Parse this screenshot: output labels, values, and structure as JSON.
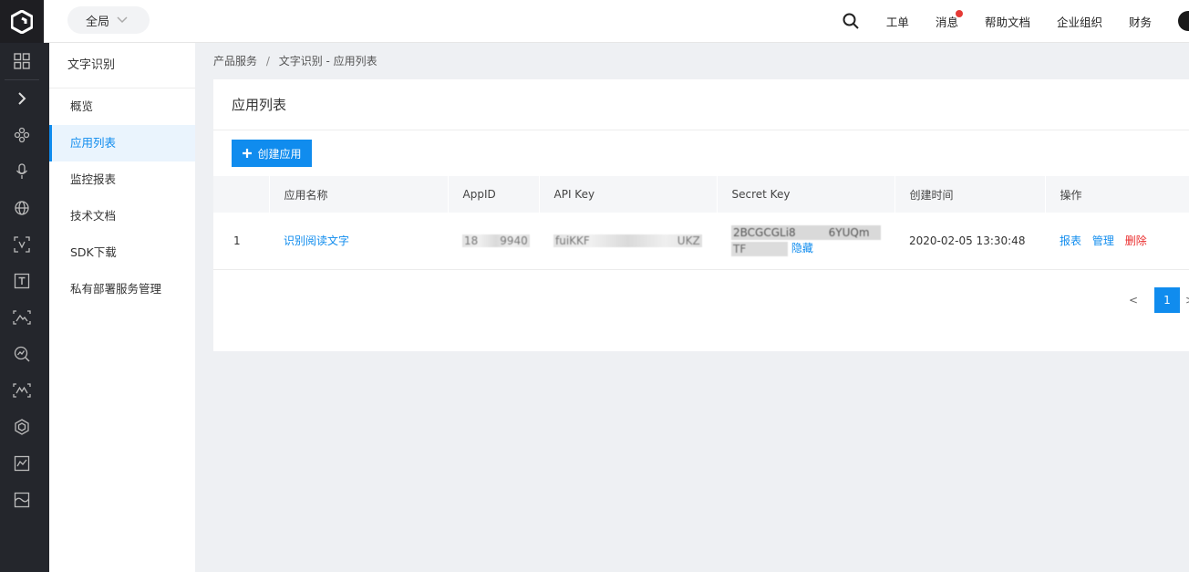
{
  "header": {
    "scope_select": "全局",
    "nav": [
      {
        "label": "工单"
      },
      {
        "label": "消息",
        "badge": true
      },
      {
        "label": "帮助文档"
      },
      {
        "label": "企业组织"
      },
      {
        "label": "财务"
      }
    ]
  },
  "sidebar": {
    "title": "文字识别",
    "items": [
      {
        "label": "概览"
      },
      {
        "label": "应用列表",
        "active": true
      },
      {
        "label": "监控报表"
      },
      {
        "label": "技术文档"
      },
      {
        "label": "SDK下载"
      },
      {
        "label": "私有部署服务管理"
      }
    ]
  },
  "breadcrumb": {
    "root": "产品服务",
    "separator": "/",
    "current": "文字识别 - 应用列表"
  },
  "card": {
    "title": "应用列表",
    "create_button": "创建应用"
  },
  "table": {
    "columns": [
      "",
      "应用名称",
      "AppID",
      "API Key",
      "Secret Key",
      "创建时间",
      "操作"
    ],
    "rows": [
      {
        "index": "1",
        "name": "识别阅读文字",
        "app_id": "18  9940",
        "api_key": "fuiKKF        UKZ",
        "secret_key_line1": "2BCGCGLi8   6YUQm",
        "secret_key_line2": "TF   ",
        "secret_hide": "隐藏",
        "created": "2020-02-05 13:30:48",
        "actions": {
          "report": "报表",
          "manage": "管理",
          "delete": "删除"
        }
      }
    ]
  },
  "pagination": {
    "prev": "<",
    "current_page": "1",
    "next": ">"
  },
  "colors": {
    "accent": "#108cee",
    "danger": "#ea2e2e",
    "rail_bg": "#24262c",
    "badge": "#e53935"
  }
}
